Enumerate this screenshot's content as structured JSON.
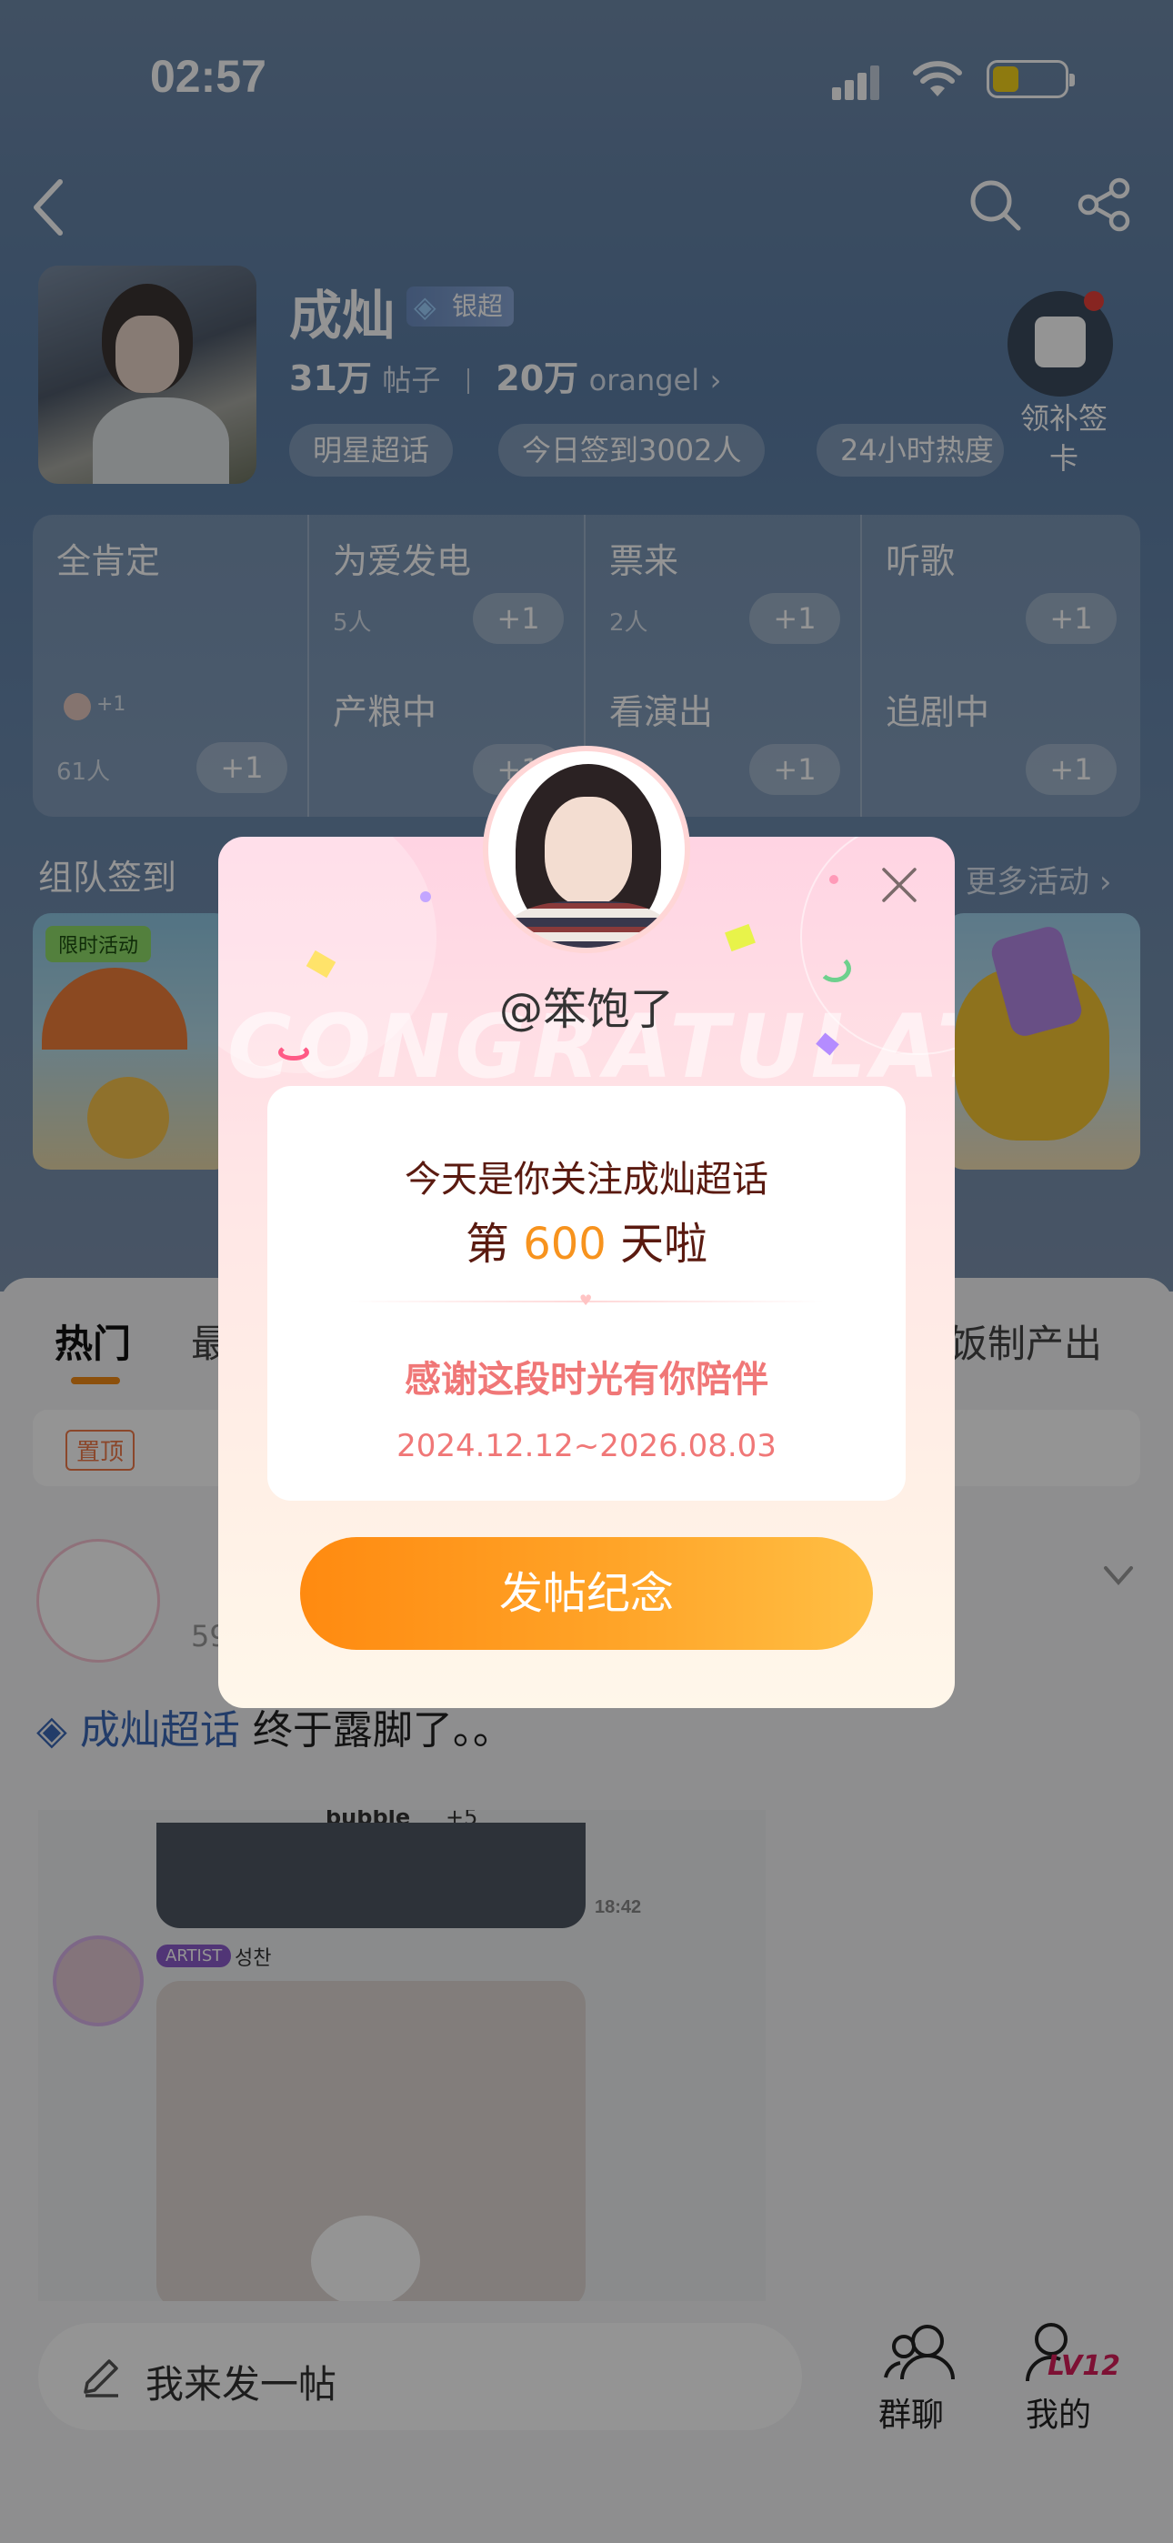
{
  "status_bar": {
    "time": "02:57"
  },
  "header": {
    "title": "成灿",
    "tier_badge": "银超",
    "posts_count": "31万",
    "posts_label": "帖子",
    "fans_count": "20万",
    "fans_label": "orangel",
    "tags": [
      "明星超话",
      "今日签到3002人",
      "24小时热度"
    ],
    "checkin_label": "领补签卡"
  },
  "grid": {
    "cells": [
      {
        "name": "全肯定",
        "count": "61人",
        "plus": "+1"
      },
      {
        "name": "为爱发电",
        "count": "5人",
        "plus": "+1"
      },
      {
        "name": "票来",
        "count": "2人",
        "plus": "+1"
      },
      {
        "name": "听歌",
        "count": "",
        "plus": "+1"
      },
      {
        "name": "产粮中",
        "count": "",
        "plus": "+1"
      },
      {
        "name": "看演出",
        "count": "",
        "plus": "+1"
      },
      {
        "name": "追剧中",
        "count": "",
        "plus": "+1"
      }
    ],
    "small_plus": "+1"
  },
  "team": {
    "title": "组队签到",
    "more": "更多活动",
    "banner_tag": "限时活动"
  },
  "tabs": {
    "items": [
      "热门",
      "最",
      "饭制产出"
    ]
  },
  "pinned": {
    "tag": "置顶"
  },
  "post": {
    "supertopic": "成灿超话",
    "text": "终于露脚了。。",
    "partial_count": "59",
    "artist_badge": "ARTIST",
    "artist_name": "성찬",
    "msg_time": "18:42",
    "bubble_text": "bubble",
    "bubble_extra": "+5"
  },
  "bottom": {
    "post_placeholder": "我来发一帖",
    "group_chat": "群聊",
    "mine": "我的",
    "level": "LV12"
  },
  "modal": {
    "username": "@笨饱了",
    "bg_word": "CONGRATULATE",
    "line1": "今天是你关注成灿超话",
    "line2_prefix": "第",
    "days": "600",
    "line2_suffix": "天啦",
    "thanks": "感谢这段时光有你陪伴",
    "date_range": "2024.12.12~2026.08.03",
    "cta": "发帖纪念"
  },
  "colors": {
    "accent_orange": "#f7931e",
    "header_blue": "#5c7ea6",
    "pink_text": "#f07777",
    "supertopic_blue": "#3b68b6"
  }
}
